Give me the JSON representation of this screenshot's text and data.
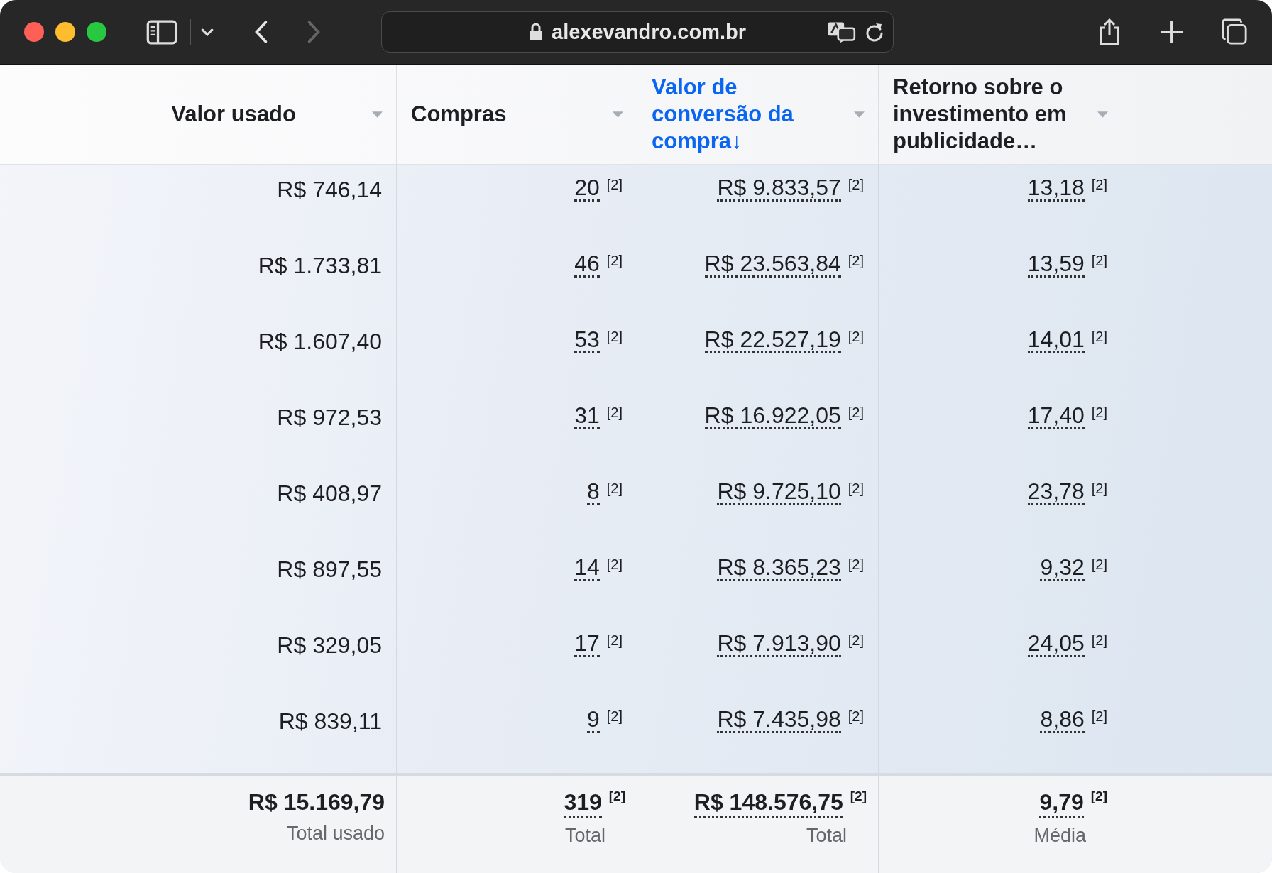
{
  "browser": {
    "url": "alexevandro.com.br",
    "back_enabled": true,
    "forward_enabled": false
  },
  "table": {
    "columns": [
      {
        "label": "Valor usado",
        "sorted": false
      },
      {
        "label": "Compras",
        "sorted": false
      },
      {
        "label": "Valor de conversão da compra",
        "sorted": true,
        "sort_arrow": "↓"
      },
      {
        "label": "Retorno sobre o investimento em publicidade…",
        "sorted": false
      }
    ],
    "rows": [
      [
        {
          "value": "R$ 746,14"
        },
        {
          "value": "20",
          "note": "[2]"
        },
        {
          "value": "R$ 9.833,57",
          "note": "[2]"
        },
        {
          "value": "13,18",
          "note": "[2]"
        }
      ],
      [
        {
          "value": "R$ 1.733,81"
        },
        {
          "value": "46",
          "note": "[2]"
        },
        {
          "value": "R$ 23.563,84",
          "note": "[2]"
        },
        {
          "value": "13,59",
          "note": "[2]"
        }
      ],
      [
        {
          "value": "R$ 1.607,40"
        },
        {
          "value": "53",
          "note": "[2]"
        },
        {
          "value": "R$ 22.527,19",
          "note": "[2]"
        },
        {
          "value": "14,01",
          "note": "[2]"
        }
      ],
      [
        {
          "value": "R$ 972,53"
        },
        {
          "value": "31",
          "note": "[2]"
        },
        {
          "value": "R$ 16.922,05",
          "note": "[2]"
        },
        {
          "value": "17,40",
          "note": "[2]"
        }
      ],
      [
        {
          "value": "R$ 408,97"
        },
        {
          "value": "8",
          "note": "[2]"
        },
        {
          "value": "R$ 9.725,10",
          "note": "[2]"
        },
        {
          "value": "23,78",
          "note": "[2]"
        }
      ],
      [
        {
          "value": "R$ 897,55"
        },
        {
          "value": "14",
          "note": "[2]"
        },
        {
          "value": "R$ 8.365,23",
          "note": "[2]"
        },
        {
          "value": "9,32",
          "note": "[2]"
        }
      ],
      [
        {
          "value": "R$ 329,05"
        },
        {
          "value": "17",
          "note": "[2]"
        },
        {
          "value": "R$ 7.913,90",
          "note": "[2]"
        },
        {
          "value": "24,05",
          "note": "[2]"
        }
      ],
      [
        {
          "value": "R$ 839,11"
        },
        {
          "value": "9",
          "note": "[2]"
        },
        {
          "value": "R$ 7.435,98",
          "note": "[2]"
        },
        {
          "value": "8,86",
          "note": "[2]"
        }
      ]
    ],
    "totals": [
      {
        "value": "R$ 15.169,79",
        "caption": "Total usado"
      },
      {
        "value": "319",
        "note": "[2]",
        "caption": "Total"
      },
      {
        "value": "R$ 148.576,75",
        "note": "[2]",
        "caption": "Total"
      },
      {
        "value": "9,79",
        "note": "[2]",
        "caption": "Média"
      }
    ]
  }
}
